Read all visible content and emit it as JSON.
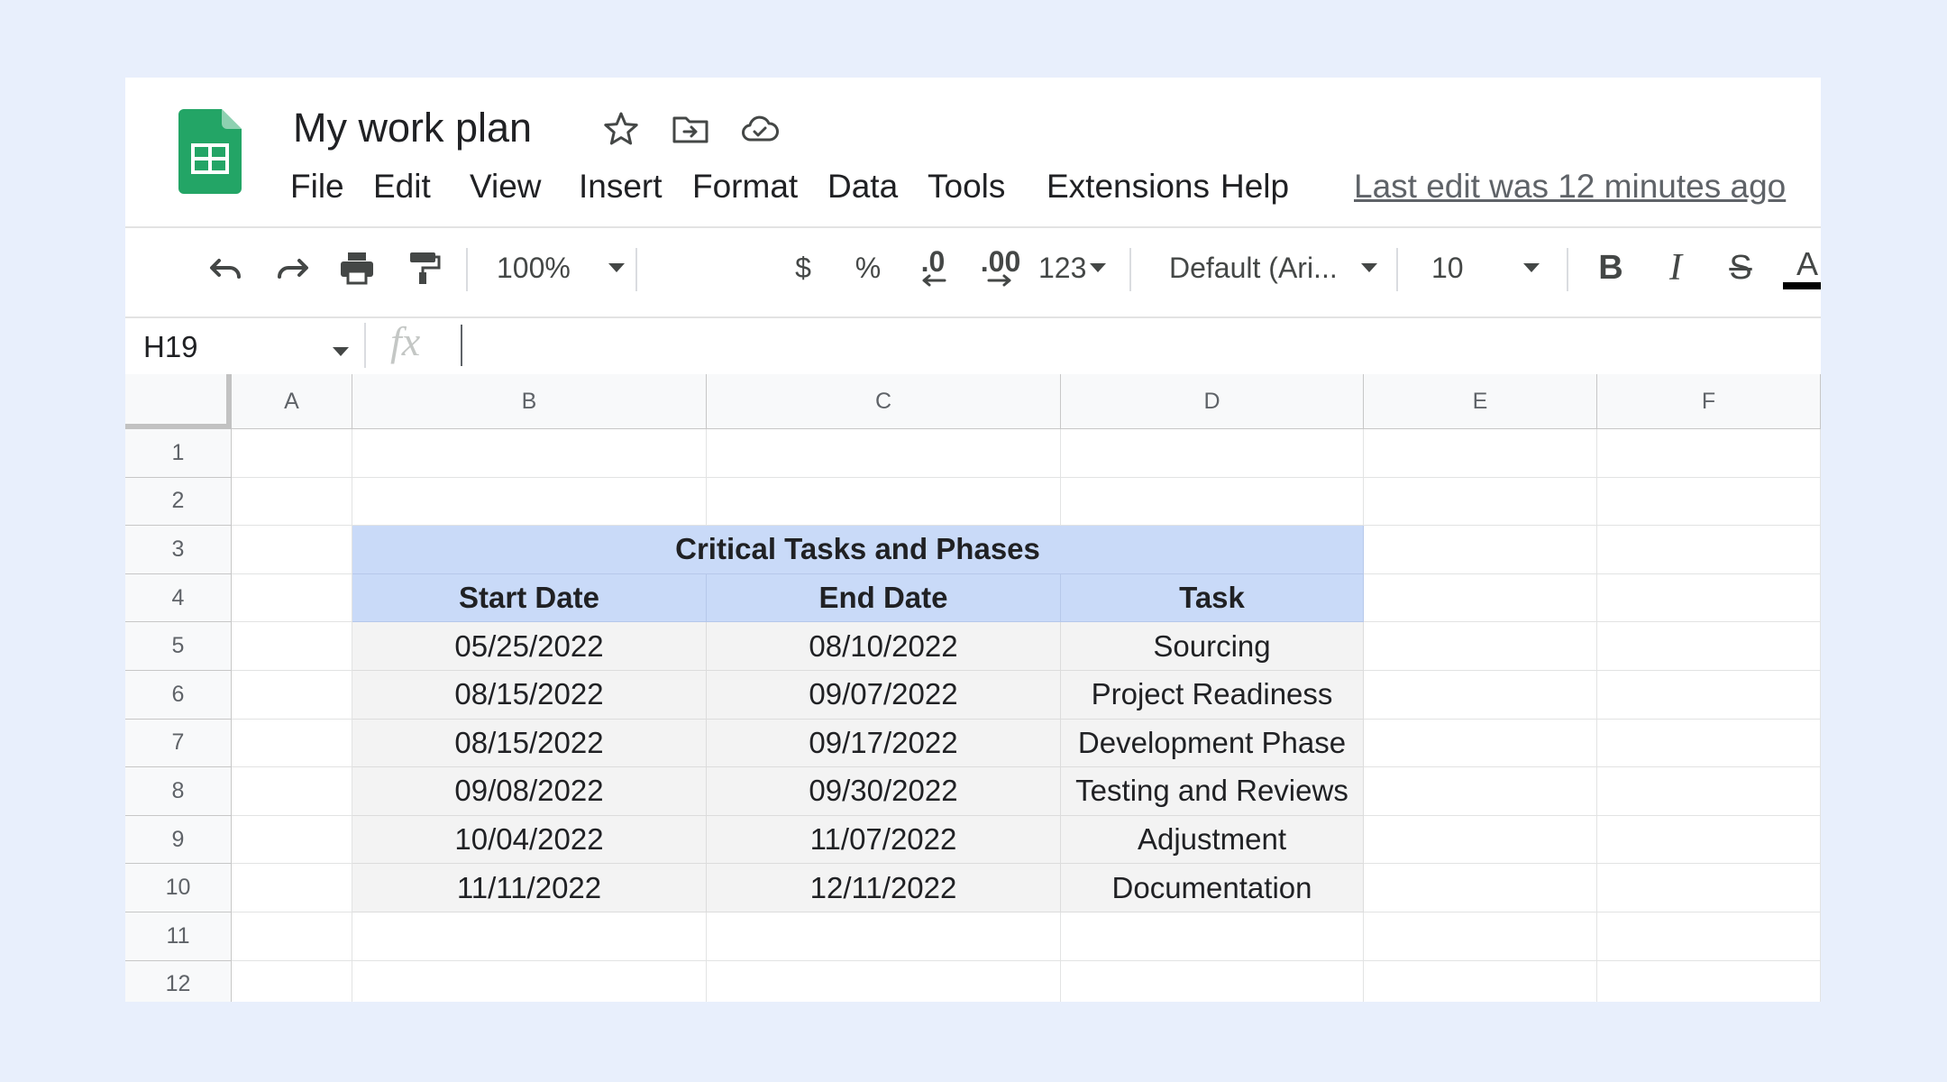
{
  "app": {
    "title": "My work plan",
    "menu": [
      "File",
      "Edit",
      "View",
      "Insert",
      "Format",
      "Data",
      "Tools",
      "Extensions",
      "Help"
    ],
    "last_edit": "Last edit was 12 minutes ago"
  },
  "toolbar": {
    "zoom": "100%",
    "currency": "$",
    "percent": "%",
    "decrease_decimal": ".0",
    "increase_decimal": ".00",
    "more_formats": "123",
    "font": "Default (Ari...",
    "font_size": "10",
    "text_color_letter": "A",
    "text_color": "#000000"
  },
  "formula_bar": {
    "name_box": "H19",
    "fx": "fx",
    "value": ""
  },
  "sheet": {
    "columns": [
      "A",
      "B",
      "C",
      "D",
      "E",
      "F"
    ],
    "rows": [
      "1",
      "2",
      "3",
      "4",
      "5",
      "6",
      "7",
      "8",
      "9",
      "10",
      "11",
      "12"
    ],
    "table_title": "Critical Tasks and Phases",
    "headers": [
      "Start Date",
      "End Date",
      "Task"
    ],
    "data": [
      [
        "05/25/2022",
        "08/10/2022",
        "Sourcing"
      ],
      [
        "08/15/2022",
        "09/07/2022",
        "Project Readiness"
      ],
      [
        "08/15/2022",
        "09/17/2022",
        "Development Phase"
      ],
      [
        "09/08/2022",
        "09/30/2022",
        "Testing and Reviews"
      ],
      [
        "10/04/2022",
        "11/07/2022",
        "Adjustment"
      ],
      [
        "11/11/2022",
        "12/11/2022",
        "Documentation"
      ]
    ]
  },
  "colors": {
    "header_fill": "#c9daf8",
    "data_fill": "#f3f3f3",
    "logo_green": "#0f9d58"
  }
}
